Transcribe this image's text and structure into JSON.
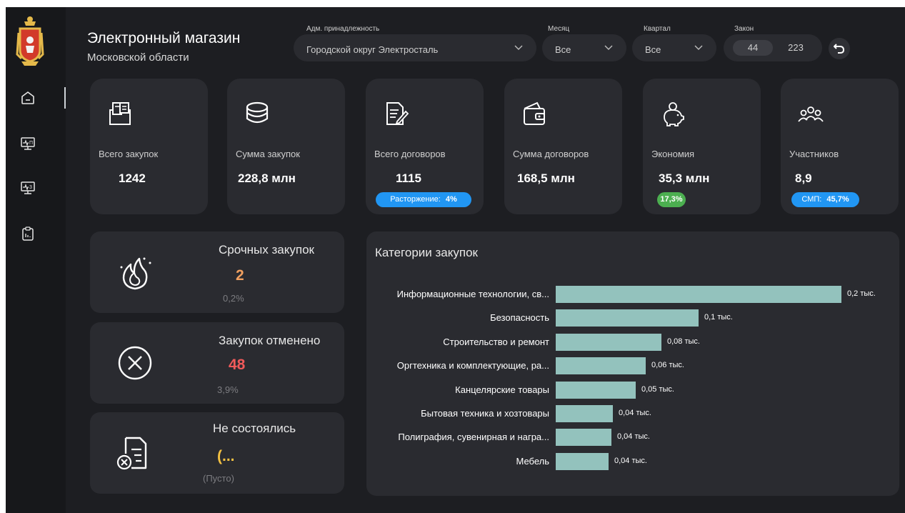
{
  "header": {
    "title": "Электронный магазин",
    "subtitle": "Московской области"
  },
  "filters": {
    "adm_label": "Адм. принадлежность",
    "adm_value": "Городской округ Электросталь",
    "month_label": "Месяц",
    "month_value": "Все",
    "quarter_label": "Квартал",
    "quarter_value": "Все",
    "law_label": "Закон",
    "law_options": [
      "44",
      "223"
    ]
  },
  "nav": {
    "items": [
      "home-icon",
      "monitor-ready-icon",
      "monitor-3-icon",
      "clipboard-report-icon"
    ],
    "monitor_p_text": "П",
    "monitor_3_text": "3"
  },
  "kpis": [
    {
      "icon": "documents-box-icon",
      "label": "Всего закупок",
      "value": "1242"
    },
    {
      "icon": "coins-stack-icon",
      "label": "Сумма закупок",
      "value": "228,8 млн"
    },
    {
      "icon": "contract-sign-icon",
      "label": "Всего договоров",
      "value": "1115",
      "badge_label": "Расторжение:",
      "badge_value": "4%",
      "badge_color": "#2196f3"
    },
    {
      "icon": "wallet-icon",
      "label": "Сумма договоров",
      "value": "168,5 млн"
    },
    {
      "icon": "piggy-bank-icon",
      "label": "Экономия",
      "value": "35,3 млн",
      "badge_value": "17,3%",
      "badge_color": "#4caf50"
    },
    {
      "icon": "participants-icon",
      "label": "Участников",
      "value": "8,9",
      "badge_label": "СМП:",
      "badge_value": "45,7%",
      "badge_color": "#2196f3"
    }
  ],
  "cards": {
    "urgent": {
      "title": "Срочных закупок",
      "value": "2",
      "sub": "0,2%",
      "color": "#f0a060"
    },
    "cancelled": {
      "title": "Закупок отменено",
      "value": "48",
      "sub": "3,9%",
      "color": "#f05a5a"
    },
    "failed": {
      "title": "Не состоялись",
      "value": "(...",
      "sub": "(Пусто)",
      "color": "#f5c242"
    }
  },
  "chart_data": {
    "type": "bar",
    "orientation": "horizontal",
    "title": "Категории закупок",
    "unit": "тыс.",
    "bar_color": "#93c2bd",
    "categories": [
      "Информационные технологии, св...",
      "Безопасность",
      "Строительство и ремонт",
      "Оргтехника и комплектующие, ра...",
      "Канцелярские товары",
      "Бытовая техника и хозтовары",
      "Полиграфия, сувенирная и награ...",
      "Мебель"
    ],
    "values": [
      0.2,
      0.1,
      0.074,
      0.063,
      0.056,
      0.04,
      0.039,
      0.037
    ],
    "labels": [
      "0,2 тыс.",
      "0,1 тыс.",
      "0,08 тыс.",
      "0,06 тыс.",
      "0,05 тыс.",
      "0,04 тыс.",
      "0,04 тыс.",
      "0,04 тыс."
    ],
    "xlim": [
      0,
      0.2
    ]
  }
}
